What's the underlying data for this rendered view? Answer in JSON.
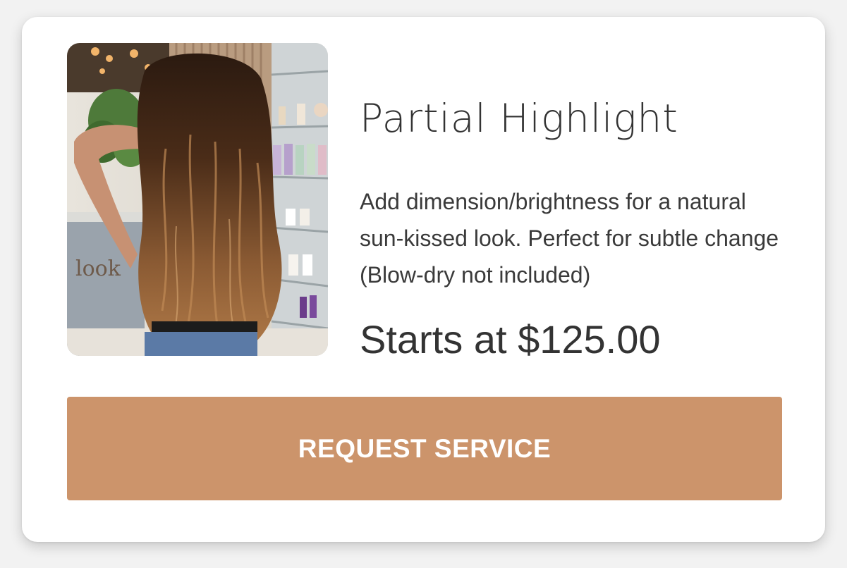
{
  "service": {
    "title": "Partial Highlight",
    "description": "Add dimension/brightness for a natural sun-kissed look. Perfect for subtle change (Blow-dry not included)",
    "price_text": "Starts at $125.00",
    "image_subject": "long-wavy-balayage-hair-salon-photo",
    "salon_sign_text": "look"
  },
  "actions": {
    "request_label": "REQUEST SERVICE"
  },
  "colors": {
    "page_bg": "#f2f2f2",
    "card_bg": "#ffffff",
    "button_bg": "#cc946b",
    "button_text": "#ffffff",
    "text": "#333333"
  }
}
